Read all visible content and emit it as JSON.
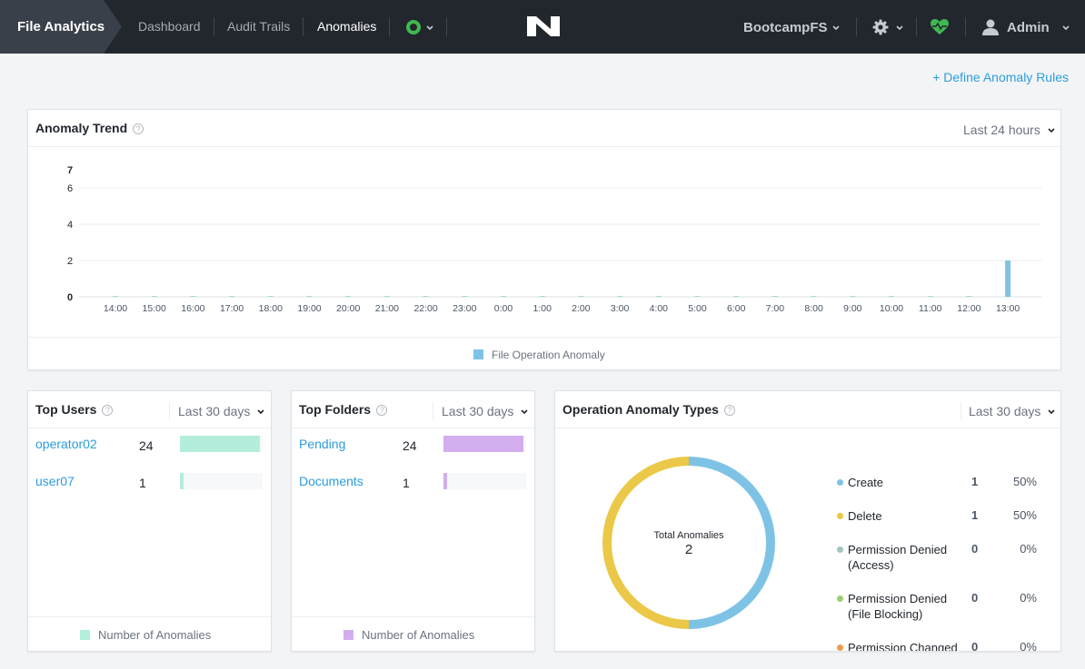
{
  "app": {
    "title": "File Analytics"
  },
  "nav": {
    "items": [
      {
        "label": "Dashboard",
        "active": false
      },
      {
        "label": "Audit Trails",
        "active": false
      },
      {
        "label": "Anomalies",
        "active": true
      }
    ]
  },
  "header": {
    "cluster": "BootcampFS",
    "user": "Admin"
  },
  "actions": {
    "define_rules": "+ Define Anomaly Rules"
  },
  "trend": {
    "title": "Anomaly Trend",
    "help": "?",
    "period": "Last 24 hours",
    "legend": "File Operation Anomaly",
    "legend_color": "#7ec3e6"
  },
  "chart_data": {
    "type": "bar",
    "categories": [
      "14:00",
      "15:00",
      "16:00",
      "17:00",
      "18:00",
      "19:00",
      "20:00",
      "21:00",
      "22:00",
      "23:00",
      "0:00",
      "1:00",
      "2:00",
      "3:00",
      "4:00",
      "5:00",
      "6:00",
      "7:00",
      "8:00",
      "9:00",
      "10:00",
      "11:00",
      "12:00",
      "13:00"
    ],
    "series": [
      {
        "name": "File Operation Anomaly",
        "values": [
          0,
          0,
          0,
          0,
          0,
          0,
          0,
          0,
          0,
          0,
          0,
          0,
          0,
          0,
          0,
          0,
          0,
          0,
          0,
          0,
          0,
          0,
          0,
          2
        ]
      }
    ],
    "y_ticks": [
      "0",
      "2",
      "4",
      "6",
      "7"
    ],
    "ylim": [
      0,
      7
    ],
    "grid": true,
    "legend": "bottom-center"
  },
  "top_users": {
    "title": "Top Users",
    "period": "Last 30 days",
    "legend": "Number of Anomalies",
    "color": "#b3eedc",
    "max": 24,
    "rows": [
      {
        "name": "operator02",
        "count": 24
      },
      {
        "name": "user07",
        "count": 1
      }
    ]
  },
  "top_folders": {
    "title": "Top Folders",
    "period": "Last 30 days",
    "legend": "Number of Anomalies",
    "color": "#d2aeee",
    "max": 24,
    "rows": [
      {
        "name": "Pending",
        "count": 24
      },
      {
        "name": "Documents",
        "count": 1
      }
    ]
  },
  "op_types": {
    "title": "Operation Anomaly Types",
    "period": "Last 30 days",
    "center_label": "Total Anomalies",
    "total": "2",
    "rows": [
      {
        "label": "Create",
        "count": "1",
        "pct": "50%",
        "color": "#7ec3e6",
        "value": 1
      },
      {
        "label": "Delete",
        "count": "1",
        "pct": "50%",
        "color": "#ebc847",
        "value": 1
      },
      {
        "label": "Permission Denied (Access)",
        "count": "0",
        "pct": "0%",
        "color": "#9fc9b8",
        "value": 0
      },
      {
        "label": "Permission Denied (File Blocking)",
        "count": "0",
        "pct": "0%",
        "color": "#9ccf6f",
        "value": 0
      },
      {
        "label": "Permission Changed",
        "count": "0",
        "pct": "0%",
        "color": "#f09b4d",
        "value": 0
      }
    ]
  }
}
